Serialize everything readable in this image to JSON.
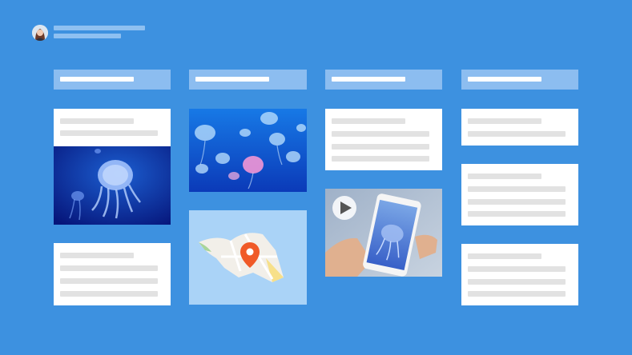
{
  "header": {
    "avatar_icon": "user-avatar-icon",
    "title": "",
    "subtitle": ""
  },
  "columns": [
    {
      "title": ""
    },
    {
      "title": ""
    },
    {
      "title": ""
    },
    {
      "title": ""
    }
  ],
  "media": {
    "jellyfish_photo_1": "jellyfish-photo",
    "jellyfish_photo_2": "jellyfish-school-photo",
    "map": "map-pin-icon",
    "video": "play-icon"
  },
  "colors": {
    "background": "#3d91e0",
    "column_header": "#8cbdf0",
    "card": "#ffffff",
    "placeholder": "#e2e2e2",
    "map_pin": "#f05a28"
  }
}
